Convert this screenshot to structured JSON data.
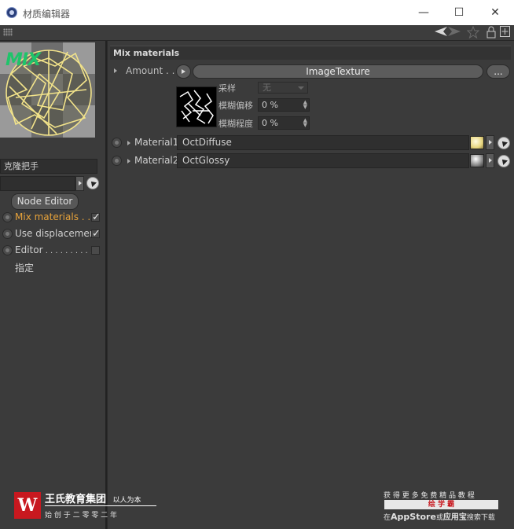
{
  "window": {
    "title": "材质编辑器",
    "minimize": "—",
    "maximize": "☐",
    "close": "✕"
  },
  "toolbar": {
    "icons": [
      "arrow-back-icon",
      "arrow-forward-icon",
      "star-icon",
      "lock-icon",
      "new-window-icon"
    ]
  },
  "left": {
    "preview_badge": "MIX",
    "name_field": "克隆把手",
    "link_field": "",
    "node_editor_label": "Node Editor",
    "channels": [
      {
        "label": "Mix materials",
        "dots": " . . .",
        "checked": true,
        "active": true
      },
      {
        "label": "Use displacement",
        "dots": "",
        "checked": true,
        "active": false
      },
      {
        "label": "Editor",
        "dots": " . . . . . . . . . .",
        "checked": false,
        "active": false
      }
    ],
    "assign_label": "指定"
  },
  "main": {
    "section_title": "Mix materials",
    "amount": {
      "label": "Amount . . .",
      "texture_button": "ImageTexture",
      "more_button": "..."
    },
    "texture_props": [
      {
        "label": "采样",
        "value": "无",
        "kind": "select"
      },
      {
        "label": "模糊偏移",
        "value": "0 %",
        "kind": "spin"
      },
      {
        "label": "模糊程度",
        "value": "0 %",
        "kind": "spin"
      }
    ],
    "materials": [
      {
        "label": "Material1",
        "value": "OctDiffuse"
      },
      {
        "label": "Material2",
        "value": "OctGlossy"
      }
    ]
  },
  "watermark": {
    "left_title": "王氏教育集团",
    "left_motto": "以人为本",
    "left_sub": "始 创 于 二 零 零 二 年",
    "logo_letter": "W",
    "right_line1": "获 得 更 多 免 费 精 品 教 程",
    "right_brand": "绘 学 霸",
    "right_line3_a": "在",
    "right_line3_b": "AppStore",
    "right_line3_c": "或",
    "right_line3_d": "应用宝",
    "right_line3_e": "搜索下载"
  },
  "colors": {
    "accent_orange": "#e8a33a",
    "logo_red": "#c8181f",
    "badge_green": "#1fc46a"
  }
}
